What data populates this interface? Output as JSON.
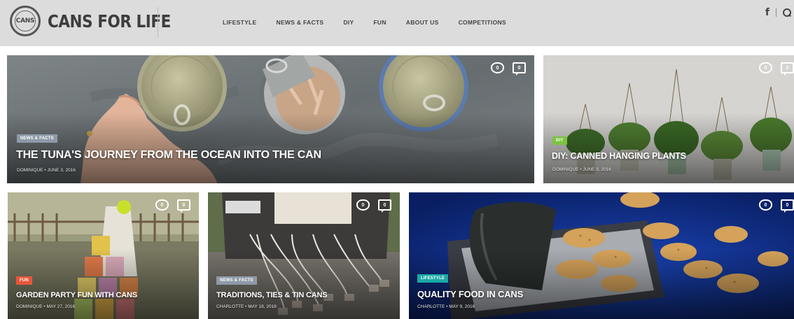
{
  "site": {
    "logo_mark": "CANS",
    "logo_text": "CANS FOR LIFE"
  },
  "nav": {
    "items": [
      "LIFESTYLE",
      "NEWS & FACTS",
      "DIY",
      "FUN",
      "ABOUT US",
      "COMPETITIONS"
    ]
  },
  "social": {
    "facebook_icon": "facebook-icon",
    "facebook_glyph": "f",
    "search_icon": "search-icon"
  },
  "colors": {
    "header_bg": "#dcdcdc",
    "tag_news": "#8e9aa8",
    "tag_diy": "#7dc242",
    "tag_fun": "#e8573a",
    "tag_lifestyle": "#1aa9a5"
  },
  "articles": [
    {
      "category": "NEWS & FACTS",
      "title": "THE TUNA'S JOURNEY FROM THE OCEAN INTO THE CAN",
      "meta": "DOMINIQUE • JUNE 3, 2016",
      "likes": "0",
      "comments": "0"
    },
    {
      "category": "DIY",
      "title": "DIY: CANNED HANGING PLANTS",
      "meta": "DOMINIQUE • JUNE 9, 2016",
      "likes": "0",
      "comments": "0"
    },
    {
      "category": "FUN",
      "title": "GARDEN PARTY FUN WITH CANS",
      "meta": "DOMINIQUE • MAY 27, 2016",
      "likes": "0",
      "comments": "0"
    },
    {
      "category": "NEWS & FACTS",
      "title": "TRADITIONS, TIES & TIN CANS",
      "meta": "CHARLOTTE • MAY 18, 2016",
      "likes": "0",
      "comments": "0"
    },
    {
      "category": "LIFESTYLE",
      "title": "QUALITY FOOD IN CANS",
      "meta": "CHARLOTTE • MAY 9, 2016",
      "likes": "0",
      "comments": "0"
    }
  ]
}
